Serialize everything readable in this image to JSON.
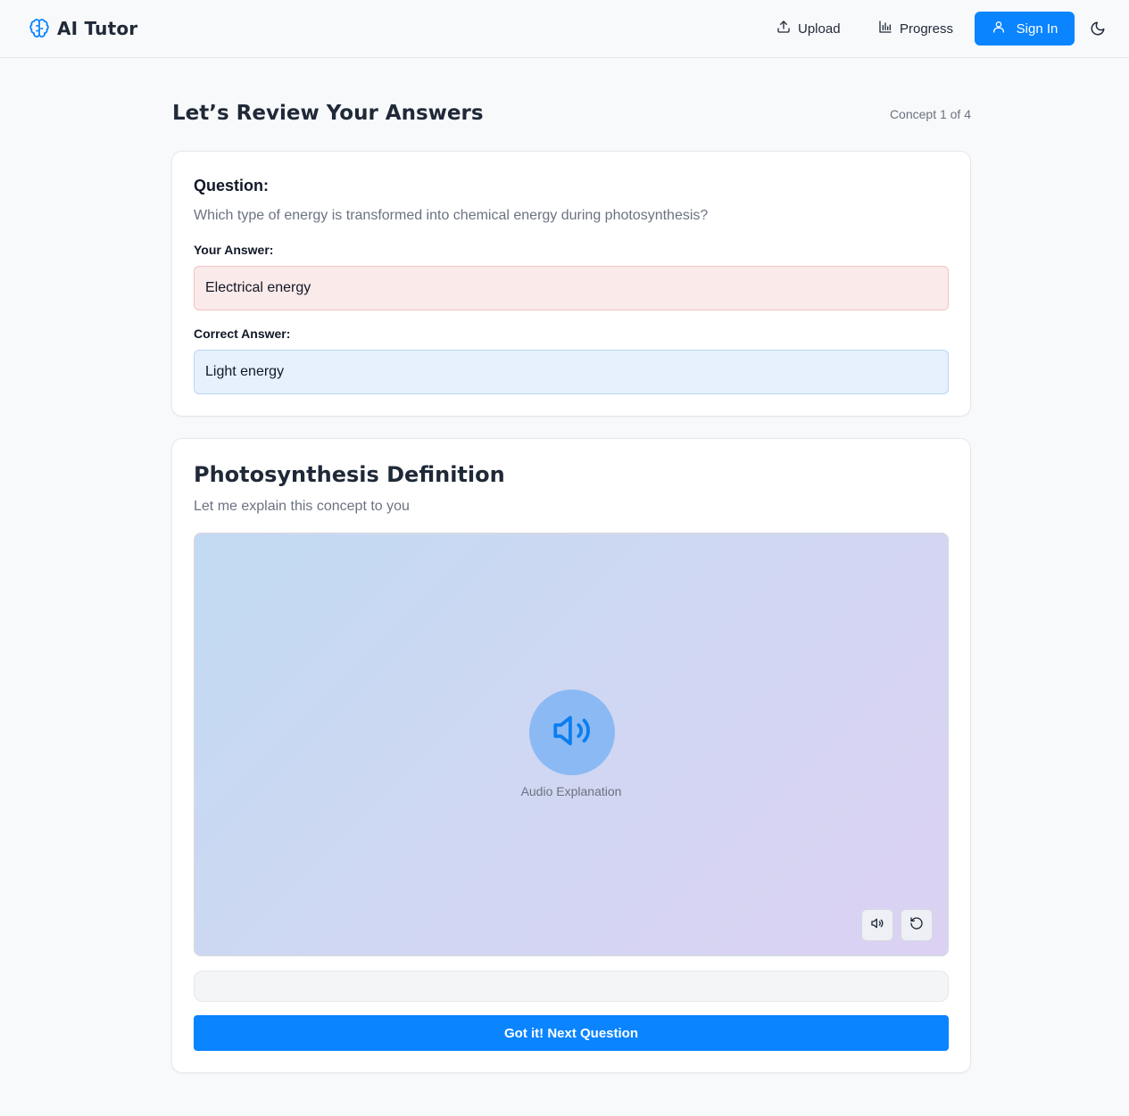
{
  "app": {
    "title": "AI Tutor",
    "icon": "brain-icon",
    "accent_color": "#0a84ff"
  },
  "nav": {
    "upload": {
      "label": "Upload",
      "icon": "upload-icon"
    },
    "progress": {
      "label": "Progress",
      "icon": "bar-chart-icon"
    },
    "sign_in": {
      "label": "Sign In",
      "icon": "user-icon"
    },
    "theme_toggle": {
      "icon": "moon-icon"
    }
  },
  "review": {
    "title": "Let’s Review Your Answers",
    "concept_counter": "Concept 1 of 4"
  },
  "question_card": {
    "question_label": "Question:",
    "question_text": "Which type of energy is transformed into chemical energy during photosynthesis?",
    "your_answer_label": "Your Answer:",
    "your_answer": "Electrical energy",
    "correct_answer_label": "Correct Answer:",
    "correct_answer": "Light energy"
  },
  "concept_card": {
    "title": "Photosynthesis Definition",
    "subtitle": "Let me explain this concept to you",
    "media": {
      "audio_label": "Audio Explanation",
      "audio_icon": "speaker-wave-icon",
      "controls": [
        "volume-icon",
        "replay-icon"
      ]
    },
    "playback_progress": 0,
    "next_button_label": "Got it! Next Question"
  }
}
